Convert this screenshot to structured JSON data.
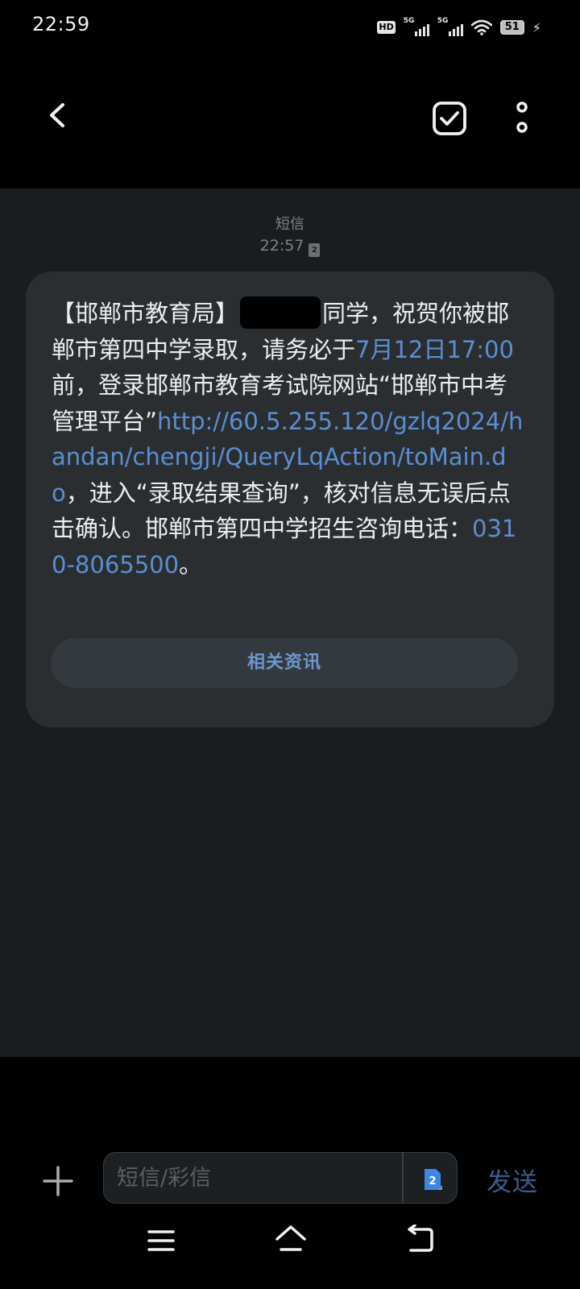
{
  "status_bar": {
    "time": "22:59",
    "hd": "HD",
    "sim1_gen": "5G",
    "sim2_gen": "5G",
    "battery": "51"
  },
  "conversation": {
    "sender": "短信",
    "time": "22:57",
    "sim_slot": "2",
    "message": {
      "part1": "【邯郸市教育局】",
      "part2": "同学，祝贺你被邯郸市第四中学录取，请务必于",
      "date_link": "7月12日17:00",
      "part3": "前，登录邯郸市教育考试院网站“邯郸市中考管理平台”",
      "url_link": "http://60.5.255.120/gzlq2024/handan/chengji/QueryLqAction/toMain.do",
      "part4": "，进入“录取结果查询”，核对信息无误后点击确认。邯郸市第四中学招生咨询电话：",
      "phone_link": "0310-8065500",
      "part5": "。"
    },
    "related_button": "相关资讯"
  },
  "composer": {
    "placeholder": "短信/彩信",
    "sim_slot": "2",
    "send_label": "发送"
  },
  "colors": {
    "link": "#5b8ed2",
    "bubble": "#2b2e31",
    "background": "#191d1f"
  }
}
